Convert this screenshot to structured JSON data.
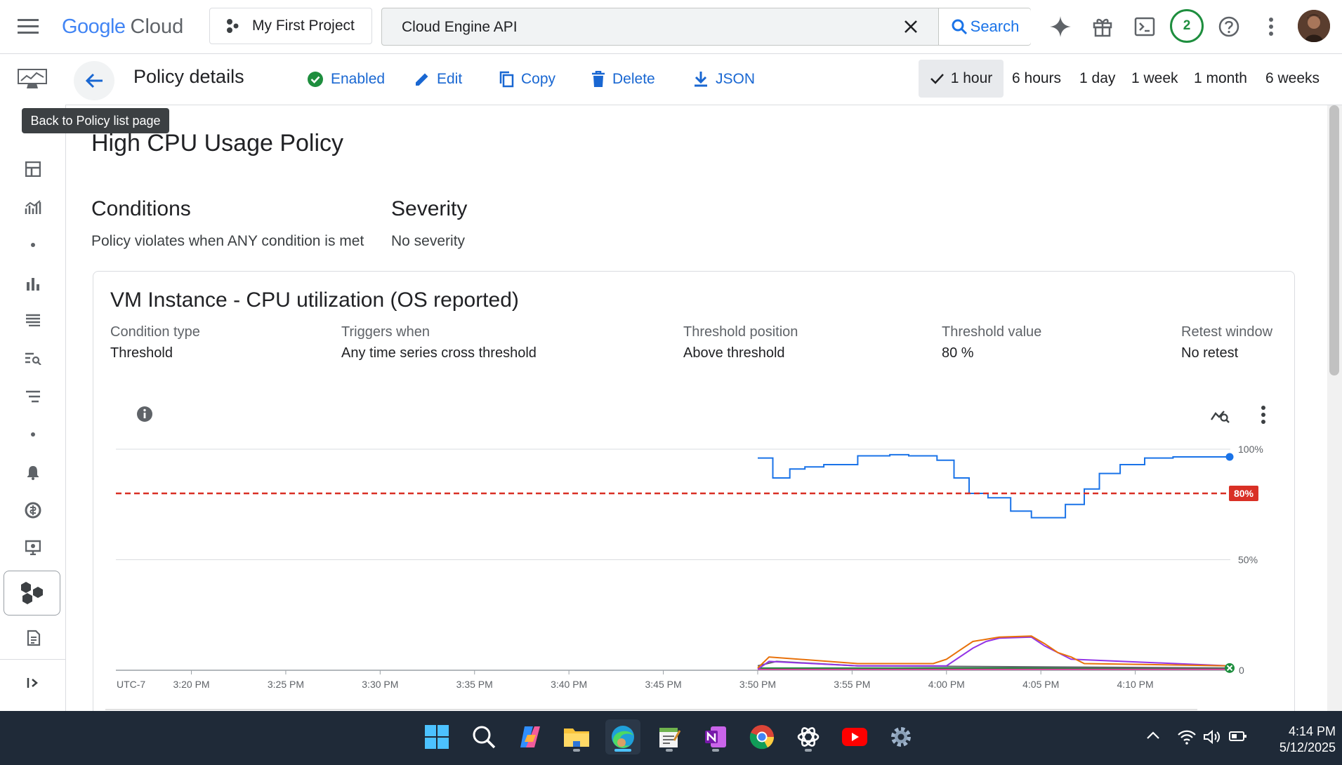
{
  "topbar": {
    "logo_google": "Google",
    "logo_cloud": "Cloud",
    "project": "My First Project",
    "search_value": "Cloud Engine API",
    "search_button": "Search",
    "notifications_count": "2"
  },
  "subbar": {
    "title": "Policy details",
    "actions": {
      "enabled": "Enabled",
      "edit": "Edit",
      "copy": "Copy",
      "delete": "Delete",
      "json": "JSON"
    },
    "time_ranges": [
      "1 hour",
      "6 hours",
      "1 day",
      "1 week",
      "1 month",
      "6 weeks"
    ],
    "selected_range": "1 hour"
  },
  "tooltip": "Back to Policy list page",
  "policy": {
    "name": "High CPU Usage Policy",
    "conditions_heading": "Conditions",
    "conditions_text": "Policy violates when ANY condition is met",
    "severity_heading": "Severity",
    "severity_text": "No severity"
  },
  "condition_card": {
    "title": "VM Instance - CPU utilization (OS reported)",
    "fields": [
      {
        "label": "Condition type",
        "value": "Threshold"
      },
      {
        "label": "Triggers when",
        "value": "Any time series cross threshold"
      },
      {
        "label": "Threshold position",
        "value": "Above threshold"
      },
      {
        "label": "Threshold value",
        "value": "80 %"
      },
      {
        "label": "Retest window",
        "value": "No retest"
      }
    ]
  },
  "chart_data": {
    "type": "line",
    "y_tick_labels": [
      "100%",
      "50%",
      "0"
    ],
    "ylim": [
      0,
      100
    ],
    "threshold": {
      "value": 80,
      "label": "80%",
      "color": "#d93025"
    },
    "x_tick_labels": [
      "UTC-7",
      "3:20 PM",
      "3:25 PM",
      "3:30 PM",
      "3:35 PM",
      "3:40 PM",
      "3:45 PM",
      "3:50 PM",
      "3:55 PM",
      "4:00 PM",
      "4:05 PM",
      "4:10 PM"
    ],
    "x_minutes_range": [
      16,
      75
    ],
    "series": [
      {
        "color": "#1a73e8",
        "x": [
          50,
          50.8,
          50.8,
          51.7,
          51.7,
          52.5,
          52.5,
          53.5,
          53.5,
          55.3,
          55.3,
          57,
          57,
          58,
          58,
          59.5,
          59.5,
          60.4,
          60.4,
          61.2,
          61.2,
          62.2,
          62.2,
          63.4,
          63.4,
          64.5,
          64.5,
          65.3,
          65.3,
          66.3,
          66.3,
          67.3,
          67.3,
          68.1,
          68.1,
          69.2,
          69.2,
          70.5,
          70.5,
          72,
          72,
          75
        ],
        "y": [
          96,
          96,
          87,
          87,
          91,
          91,
          92,
          92,
          93,
          93,
          97,
          97,
          97.5,
          97.5,
          97,
          97,
          95,
          95,
          87,
          87,
          80,
          80,
          78,
          78,
          72,
          72,
          69,
          69,
          69,
          69,
          75,
          75,
          82,
          82,
          89,
          89,
          93,
          93,
          96,
          96,
          96.5,
          96.5
        ]
      },
      {
        "color": "#e8710a",
        "x": [
          50,
          50.6,
          50.6,
          55.3,
          55.3,
          59.3,
          59.3,
          60.0,
          60.0,
          60.7,
          60.7,
          61.4,
          61.4,
          62.1,
          62.1,
          62.8,
          62.8,
          64.5,
          64.5,
          65.2,
          65.2,
          65.9,
          65.9,
          66.6,
          66.6,
          67.3,
          67.3,
          75
        ],
        "y": [
          1,
          6,
          6,
          3,
          3,
          3,
          3,
          5,
          5,
          9,
          9,
          13,
          13,
          14,
          14,
          15,
          15,
          15.5,
          15.5,
          12,
          12,
          8,
          8,
          6,
          6,
          3,
          3,
          2
        ]
      },
      {
        "color": "#9334e6",
        "x": [
          50,
          50.6,
          50.6,
          55.3,
          55.3,
          60.0,
          60.0,
          61.4,
          61.4,
          62.1,
          62.1,
          62.8,
          62.8,
          64.5,
          64.5,
          65.2,
          65.2,
          66.6,
          66.6,
          75
        ],
        "y": [
          0.5,
          4,
          4,
          2,
          2,
          2,
          2,
          10,
          10,
          13,
          13,
          14.5,
          14.5,
          15,
          15,
          11,
          11,
          5,
          5,
          2
        ]
      },
      {
        "color": "#1e8e3e",
        "x": [
          50,
          75
        ],
        "y": [
          1,
          1
        ]
      },
      {
        "color": "#5f6368",
        "x": [
          50,
          51,
          51,
          55.3,
          55.3,
          75
        ],
        "y": [
          2,
          4,
          4,
          2,
          2,
          1
        ]
      },
      {
        "color": "#e52592",
        "x": [
          50,
          75
        ],
        "y": [
          0.5,
          0.5
        ]
      }
    ]
  },
  "taskbar": {
    "time": "4:14 PM",
    "date": "5/12/2025"
  }
}
